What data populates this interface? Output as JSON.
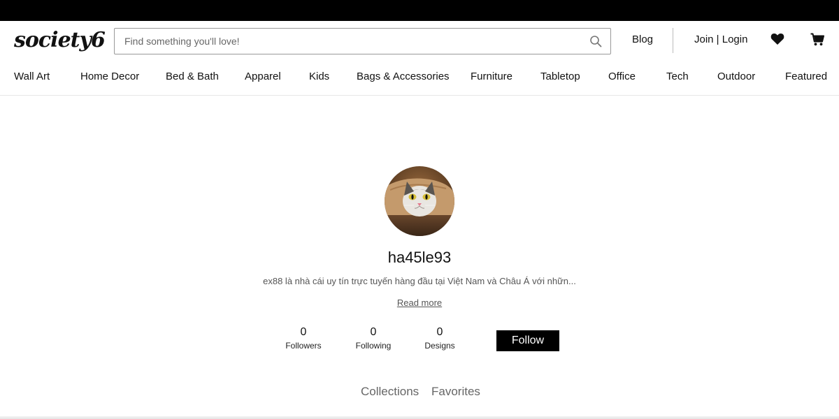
{
  "header": {
    "logo_text": "society6",
    "search_placeholder": "Find something you'll love!",
    "search_icon": "search-icon",
    "blog_label": "Blog",
    "login_label": "Join | Login",
    "wishlist_icon": "heart-icon",
    "cart_icon": "cart-icon"
  },
  "nav": {
    "items": [
      {
        "label": "Wall Art"
      },
      {
        "label": "Home Decor"
      },
      {
        "label": "Bed & Bath"
      },
      {
        "label": "Apparel"
      },
      {
        "label": "Kids"
      },
      {
        "label": "Bags & Accessories"
      },
      {
        "label": "Furniture"
      },
      {
        "label": "Tabletop"
      },
      {
        "label": "Office"
      },
      {
        "label": "Tech"
      },
      {
        "label": "Outdoor"
      },
      {
        "label": "Featured"
      }
    ]
  },
  "profile": {
    "username": "ha45le93",
    "bio": "ex88 là nhà cái uy tín trực tuyến hàng đầu tại Việt Nam và Châu Á với nhữn...",
    "read_more": "Read more",
    "stats": [
      {
        "count": "0",
        "label": "Followers"
      },
      {
        "count": "0",
        "label": "Following"
      },
      {
        "count": "0",
        "label": "Designs"
      }
    ],
    "follow_label": "Follow"
  },
  "tabs": [
    {
      "label": "Collections"
    },
    {
      "label": "Favorites"
    }
  ],
  "colors": {
    "topbar": "#000000",
    "follow_button": "#000000",
    "muted_text": "#666666"
  }
}
